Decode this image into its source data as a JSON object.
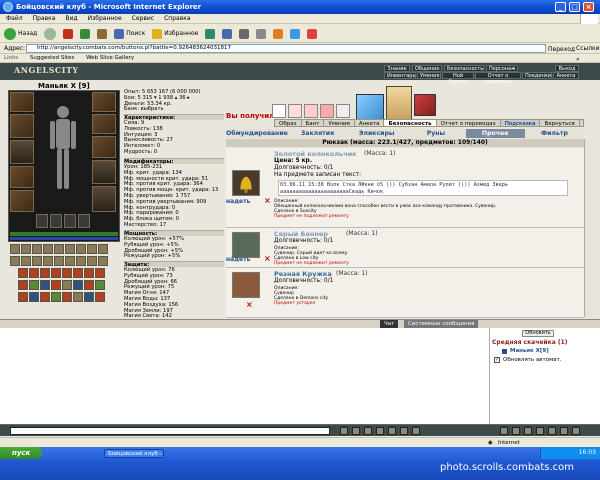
{
  "window": {
    "title": "Бойцовский клуб - Microsoft Internet Explorer",
    "menu": [
      "Файл",
      "Правка",
      "Вид",
      "Избранное",
      "Сервис",
      "Справка"
    ]
  },
  "toolbar": {
    "back": "Назад",
    "search": "Поиск",
    "favorites": "Избранное"
  },
  "address": {
    "label": "Адрес:",
    "url": "http://angelscity.combats.com/buttons.pl?battle=0.926483624031817",
    "go": "Переход",
    "links": "Ссылки »"
  },
  "linksbar": {
    "label": "Links",
    "items": [
      "Suggested Sites",
      "Web Slice Gallery"
    ]
  },
  "game": {
    "logo": "ANGELSCITY",
    "nav_top": [
      "Знание",
      "Общение",
      "Безопасность",
      "Персонаж",
      "Выход"
    ],
    "nav_bottom": [
      "Инвентарь",
      "Умения",
      "Нoй Скролл",
      "Отчет о переводах",
      "Поединки",
      "Анкета"
    ],
    "character": {
      "name": "Маньяк Х [9]"
    },
    "top_stats": [
      "Опыт: 5 653 167 (6 000 000)",
      "Бои: 5 315 ▾ 1 938 ▴ 36 ▸",
      "Деньги: 53.34 кр.",
      "Банк: выбрать"
    ],
    "characteristics_label": "Характеристики:",
    "characteristics": [
      "Сила: 9",
      "Ловкость: 138",
      "Интуиция: 3",
      "Выносливость: 27",
      "Интеллект: 0",
      "Мудрость: 0"
    ],
    "modifiers_label": "Модификаторы:",
    "modifiers": [
      "Урон: 185-231",
      "Мф. крит. удара: 134",
      "Мф. мощности крит. удара: 51",
      "Мф. против крит. удара: 364",
      "Мф. против мощн. крит. удара: 13",
      "Мф. увертывания: 1 757",
      "Мф. против увертывания: 909",
      "Мф. контрудара: 0",
      "Мф. парирования: 0",
      "Мф. блока щитом: 0",
      "Мастерство: 17"
    ],
    "power_label": "Мощность:",
    "power": [
      "Колющий урон: +57%",
      "Рубящий урон: +5%",
      "Дробящий урон: +5%",
      "Режущий урон: +5%"
    ],
    "protection_label": "Защита:",
    "protection": [
      "Колющий урон: 76",
      "Рубящий урон: 73",
      "Дробящий урон: 66",
      "Режущий урон: 75",
      "Магия Огня: 147",
      "Магия Воды: 137",
      "Магия Воздуха: 156",
      "Магия Земли: 197",
      "Магия Света: 142"
    ],
    "received_label": "Вы получили",
    "tabs1": [
      "Образ",
      "Бант",
      "Умения",
      "Анкета",
      "Безопасность",
      "Отчет о переводах",
      "Подсказка",
      "Вернуться"
    ],
    "tabs2": [
      "Обмундирование",
      "Заклятия",
      "Эликсиры",
      "Руны",
      "Прочее",
      "Фильтр"
    ],
    "backpack": "Рюкзак (масса: 223.1/427, предметов: 109/140)",
    "items": [
      {
        "name": "Золотой колокольчик",
        "mass": "(Масса: 1)",
        "price": "Цена: 5 кр.",
        "durability": "Долговечность: 0/1",
        "inscription_label": "На предмете записан текст:",
        "inscription1": "03.06.11 15:38 Волк Стка Л#кни ©5 ))) Субхан Амала Рулит )))) Ахмед Зверь",
        "inscription2": "ааааааааааааааааааааааСвадь Кичок",
        "desc_label": "Описание:",
        "desc": "Обещанный колокольчиками вона способен вести в ужас все команду противника. Сувенир.",
        "made": "Сделано в Suncity",
        "repair": "Предмет не подлежит ремонту",
        "action": "надеть"
      },
      {
        "name": "Серый Баннер",
        "mass": "(Масса: 1)",
        "durability": "Долговечность: 0/1",
        "desc_label": "Описание:",
        "desc": "Сувенир. Серый идет ко всему.",
        "made": "Сделано в Low city",
        "repair": "Предмет не подлежит ремонту",
        "action": "надеть"
      },
      {
        "name": "Резная Кружка",
        "mass": "(Масса: 1)",
        "durability": "Долговечность: 0/1",
        "desc_label": "Описание:",
        "desc": "Сувенир",
        "made": "Сделано в Demons city",
        "repair": "Предмет устарел"
      }
    ]
  },
  "chat": {
    "tab_chat": "Чат",
    "tab_system": "Системные сообщения",
    "refresh": "Обновить",
    "room_title": "Средняя скачейка (1)",
    "user": "Маньяк Х[9]",
    "auto_label": "Обновлять автомат."
  },
  "statusbar": {
    "zone": "Internet"
  },
  "taskbar": {
    "start": "пуск",
    "item": "Бойцовский клуб - Mi...",
    "clock": "16:03"
  },
  "watermark": "photo.scrolls.combats.com",
  "colors": {
    "titlebar": "#0a4bd0",
    "game_header": "#3d4a4a",
    "received": "#c00000",
    "link": "#3b6aa0"
  }
}
